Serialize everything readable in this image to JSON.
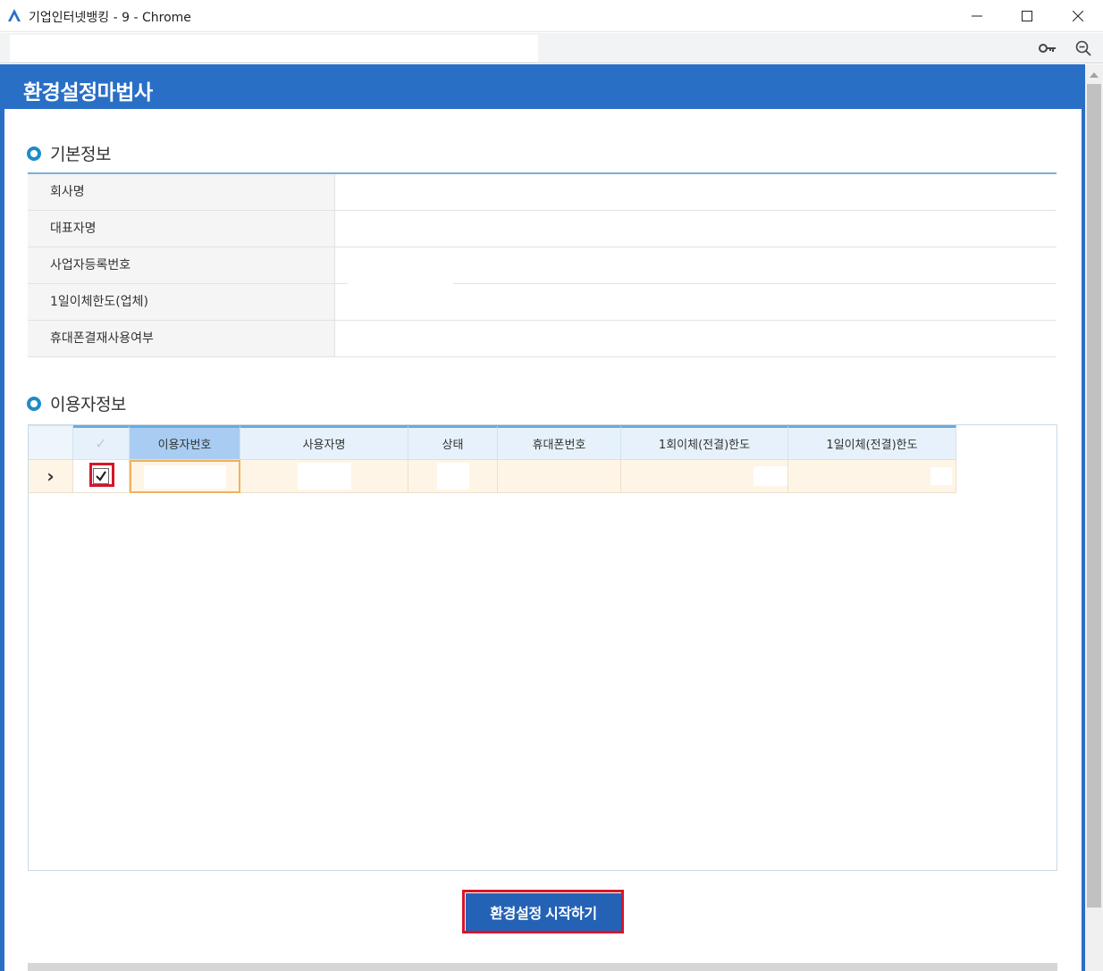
{
  "window": {
    "title": "기업인터넷뱅킹 - 9 - Chrome",
    "icon": "bank-app-icon"
  },
  "toolbar": {
    "icons": [
      "key-icon",
      "zoom-out-icon"
    ]
  },
  "page": {
    "title": "환경설정마법사"
  },
  "basic_info": {
    "title": "기본정보",
    "rows": [
      {
        "label": "회사명",
        "value": ""
      },
      {
        "label": "대표자명",
        "value": ""
      },
      {
        "label": "사업자등록번호",
        "value": ""
      },
      {
        "label": "1일이체한도(업체)",
        "value": ""
      },
      {
        "label": "휴대폰결재사용여부",
        "value": ""
      }
    ]
  },
  "user_info": {
    "title": "이용자정보",
    "columns": [
      "",
      "✓",
      "이용자번호",
      "사용자명",
      "상태",
      "휴대폰번호",
      "1회이체(전결)한도",
      "1일이체(전결)한도"
    ],
    "rows": [
      {
        "expander": "›",
        "checked": true,
        "user_no": "",
        "user_name": "",
        "status": "",
        "phone": "",
        "per_transfer_limit": "",
        "daily_limit": ""
      }
    ]
  },
  "actions": {
    "start_label": "환경설정 시작하기"
  },
  "colors": {
    "header_blue": "#2a6fc6",
    "button_blue": "#2462b6",
    "highlight_red": "#d7152a",
    "row_selected": "#fff5e6"
  }
}
